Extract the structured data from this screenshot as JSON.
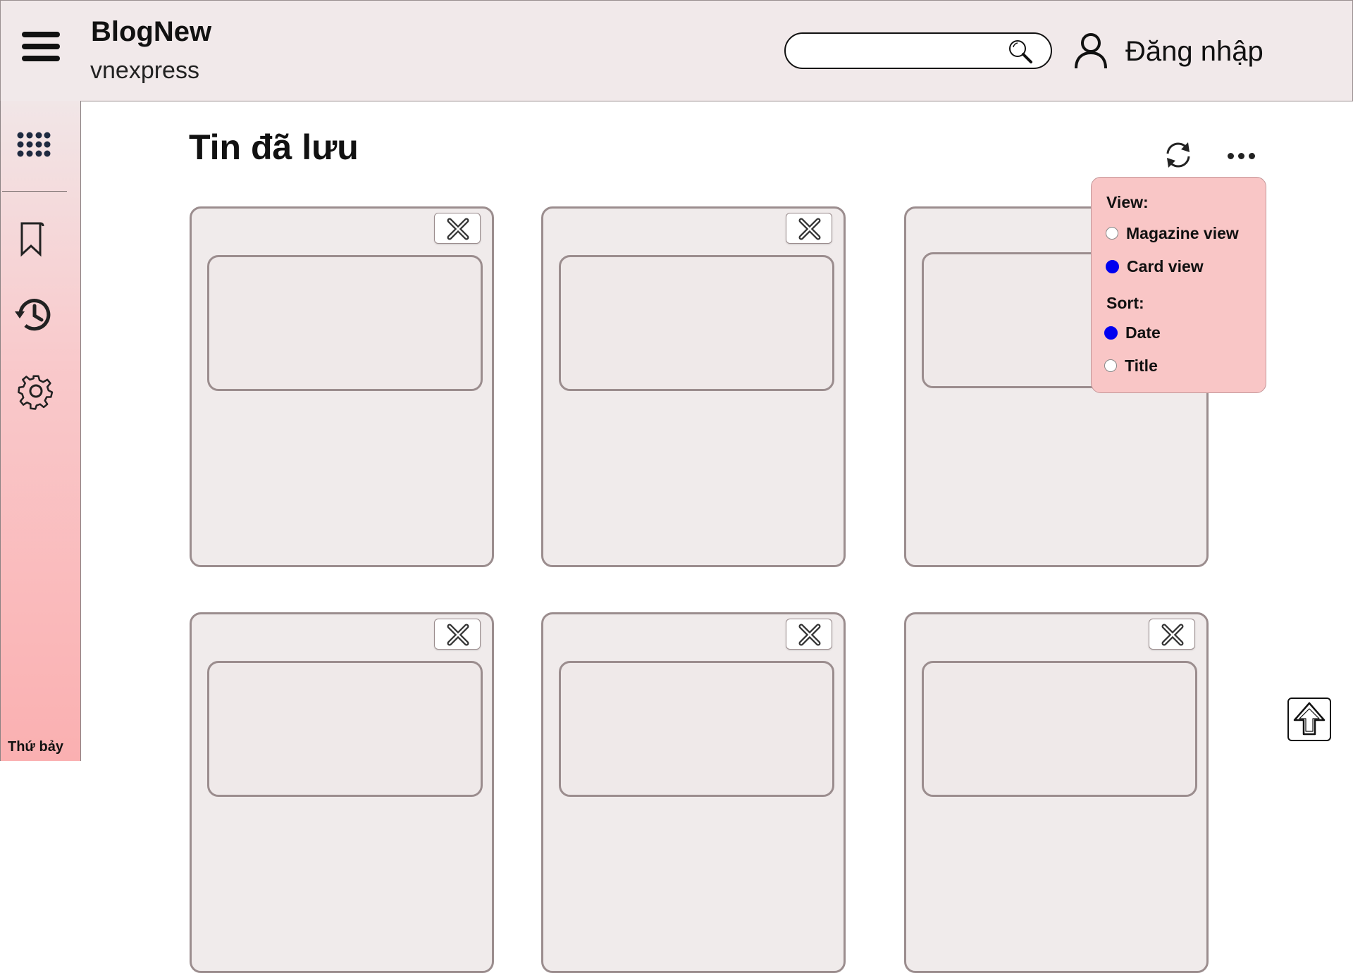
{
  "header": {
    "brand": "BlogNew",
    "subtitle": "vnexpress",
    "search_placeholder": "",
    "login_label": "Đăng nhập",
    "icons": [
      "menu-icon",
      "search-icon",
      "user-icon"
    ]
  },
  "sidebar": {
    "items": [
      {
        "name": "apps-grid-icon"
      },
      {
        "name": "bookmark-icon"
      },
      {
        "name": "history-icon"
      },
      {
        "name": "settings-icon"
      }
    ],
    "day_label": "Thứ bảy"
  },
  "main": {
    "title": "Tin đã lưu",
    "card_count": 6
  },
  "view_menu": {
    "view_label": "View:",
    "view_options": [
      {
        "label": "Magazine view",
        "selected": false
      },
      {
        "label": "Card view",
        "selected": true
      }
    ],
    "sort_label": "Sort:",
    "sort_options": [
      {
        "label": "Date",
        "selected": true
      },
      {
        "label": "Title",
        "selected": false
      }
    ]
  },
  "colors": {
    "header_bg": "#f1e9ea",
    "card_bg": "#f0ebeb",
    "card_border": "#9b8d8e",
    "popup_bg": "#f9c6c6",
    "radio_selected": "#0000f0"
  }
}
